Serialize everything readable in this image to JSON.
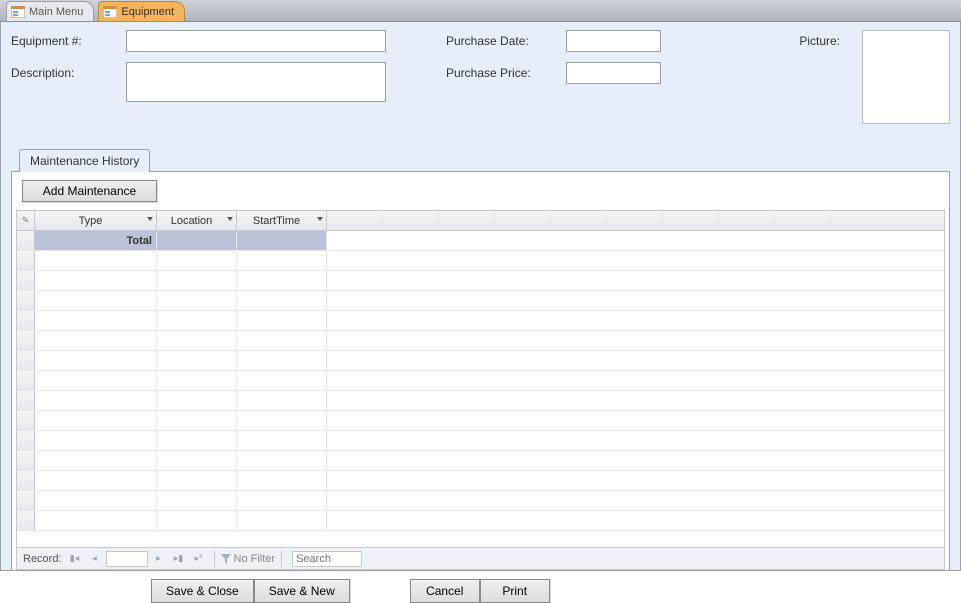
{
  "tabs": {
    "main_menu": "Main Menu",
    "equipment": "Equipment"
  },
  "fields": {
    "equipment_no_label": "Equipment #:",
    "equipment_no_value": "",
    "description_label": "Description:",
    "description_value": "",
    "purchase_date_label": "Purchase Date:",
    "purchase_date_value": "",
    "purchase_price_label": "Purchase Price:",
    "purchase_price_value": "",
    "picture_label": "Picture:"
  },
  "subtab": {
    "label": "Maintenance History",
    "add_button": "Add Maintenance"
  },
  "grid": {
    "columns": [
      "Type",
      "Location",
      "StartTime"
    ],
    "total_label": "Total"
  },
  "record_nav": {
    "label": "Record:",
    "current": "",
    "filter_text": "No Filter",
    "search_placeholder": "Search"
  },
  "buttons": {
    "save_close": "Save & Close",
    "save_new": "Save & New",
    "cancel": "Cancel",
    "print": "Print"
  }
}
